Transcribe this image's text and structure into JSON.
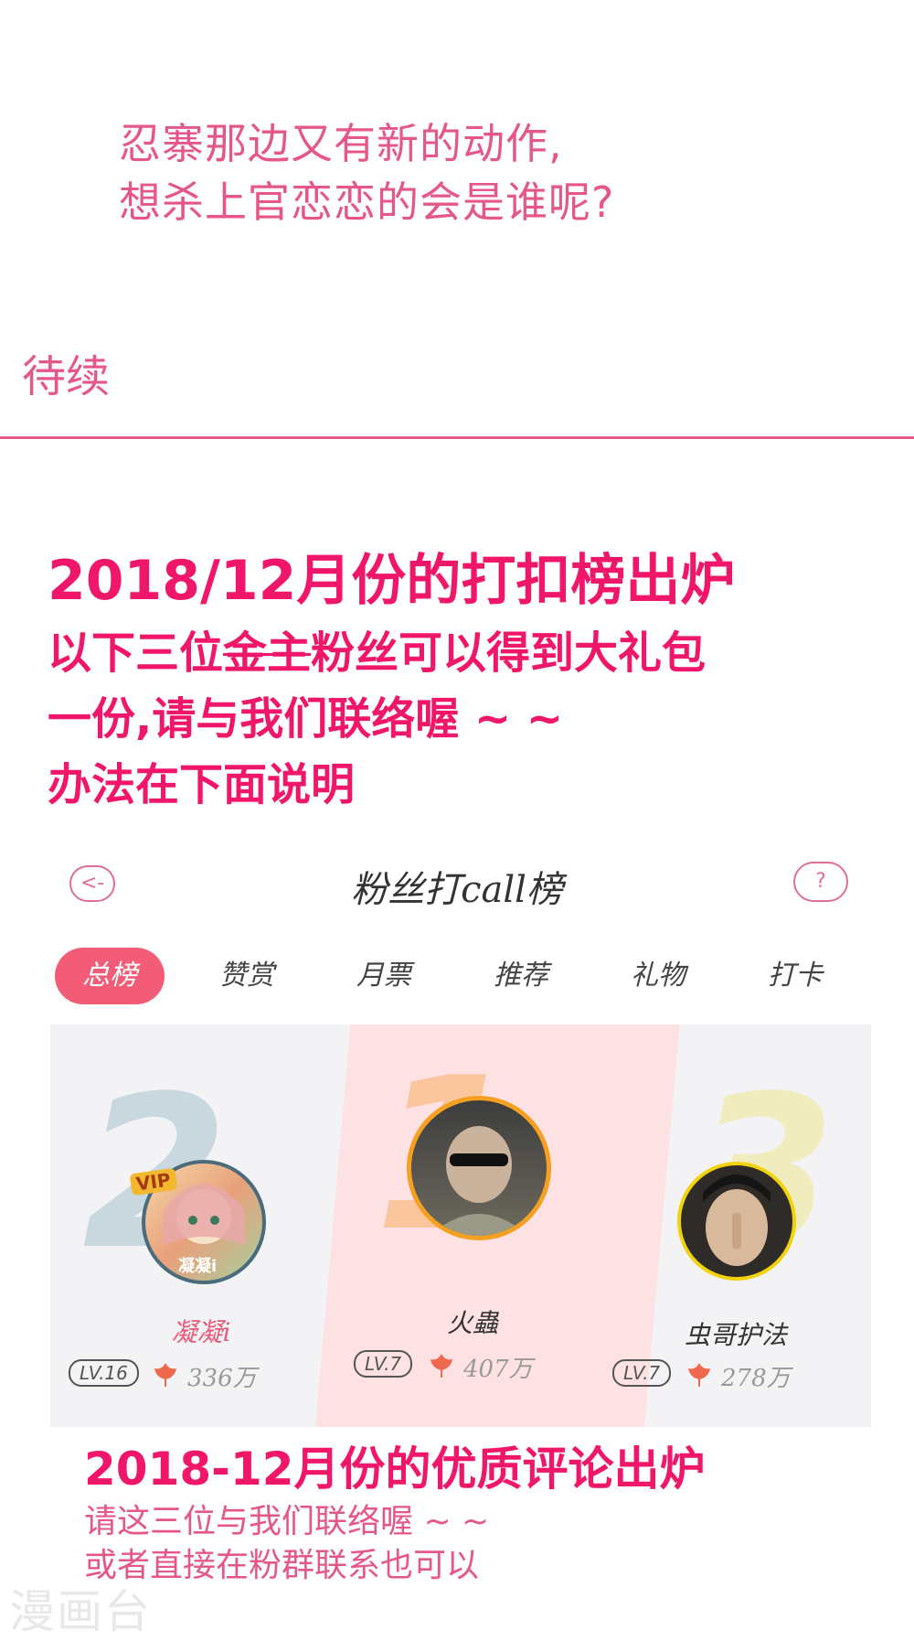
{
  "story": {
    "lines": [
      "忍寨那边又有新的动作,",
      "想杀上官恋恋的会是谁呢?"
    ],
    "to_be_continued": "待续"
  },
  "announcement": {
    "title": "2018/12月份的打扣榜出炉",
    "line1_prefix": "以下三位",
    "line1_strike": "金主",
    "line1_suffix": "粉丝可以得到大礼包",
    "line2": "一份,请与我们联络喔 ~ ~",
    "line3": "办法在下面说明"
  },
  "ranking": {
    "back_label": "<-",
    "help_label": "?",
    "title": "粉丝打call榜",
    "tabs": [
      "总榜",
      "赞赏",
      "月票",
      "推荐",
      "礼物",
      "打卡"
    ],
    "active_tab": 0,
    "podium": [
      {
        "rank": "2",
        "name": "凝凝i",
        "level": "LV.16",
        "score": "336万",
        "vip": "VIP",
        "avatar_tag": "凝凝i"
      },
      {
        "rank": "1",
        "name": "火蟲",
        "level": "LV.7",
        "score": "407万"
      },
      {
        "rank": "3",
        "name": "虫哥护法",
        "level": "LV.7",
        "score": "278万"
      }
    ]
  },
  "comments": {
    "title": "2018-12月份的优质评论出炉",
    "line1": "请这三位与我们联络喔 ~ ~",
    "line2": "或者直接在粉群联系也可以"
  },
  "watermark": "漫画台",
  "colors": {
    "story_pink": "#e5578a",
    "announce_red": "#f0176b",
    "tab_active": "#f35c77"
  }
}
